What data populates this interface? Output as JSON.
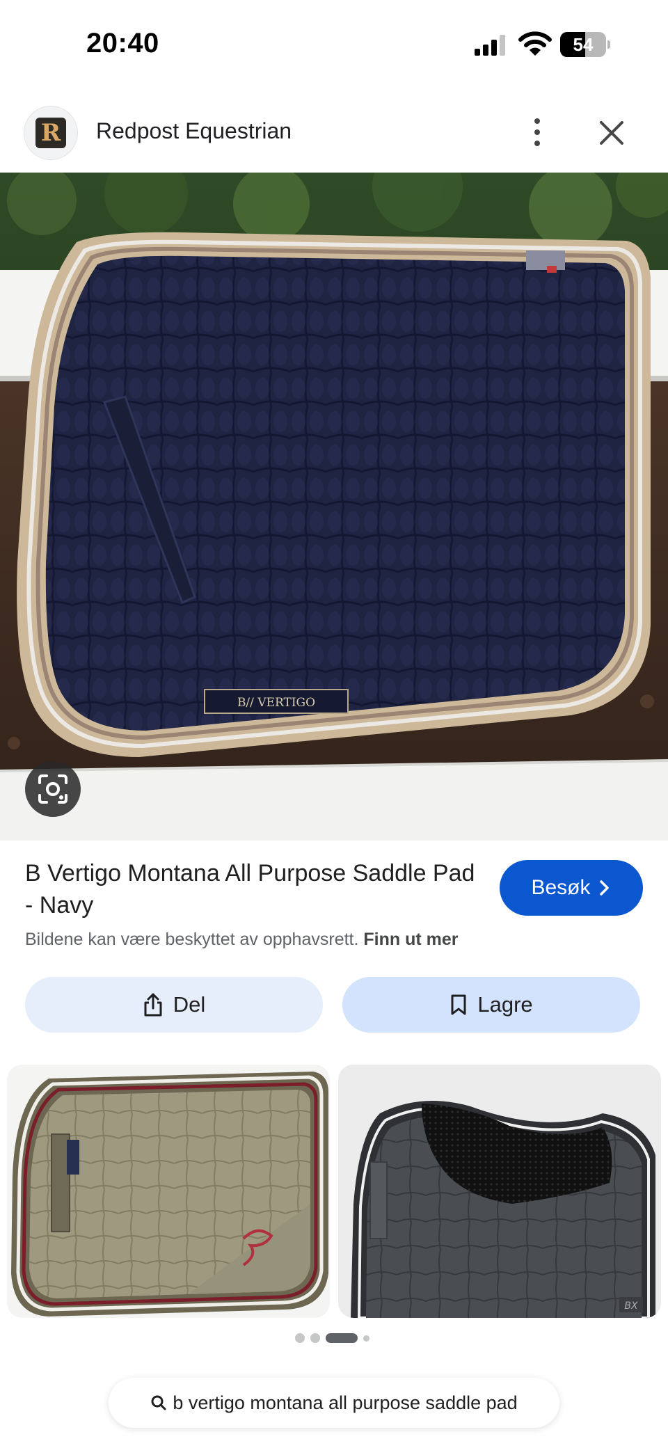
{
  "status_bar": {
    "time": "20:40",
    "battery_level": "54",
    "battery_percent": 54
  },
  "source": {
    "logo_letter": "R",
    "name": "Redpost Equestrian"
  },
  "main_image": {
    "label_text": "B// VERTIGO"
  },
  "product": {
    "title": "B Vertigo Montana All Purpose Saddle Pad - Navy",
    "visit_label": "Besøk",
    "copyright_text": "Bildene kan være beskyttet av opphavsrett.",
    "learn_more": "Finn ut mer"
  },
  "actions": {
    "share_label": "Del",
    "save_label": "Lagre"
  },
  "related": {
    "thumb_2_badge": "BX"
  },
  "pagination": {
    "active_index": 2
  },
  "search": {
    "query": "b vertigo montana all purpose saddle pad"
  },
  "colors": {
    "accent": "#0b57d0",
    "share_bg": "#e6edfb",
    "save_bg": "#d3e3fd",
    "pad_navy": "#1e2340",
    "pad_trim": "#cdb99a"
  },
  "icons": [
    "signal-icon",
    "wifi-icon",
    "battery-icon",
    "more-vert-icon",
    "close-icon",
    "lens-icon",
    "chevron-right-icon",
    "share-icon",
    "bookmark-icon",
    "search-icon"
  ]
}
